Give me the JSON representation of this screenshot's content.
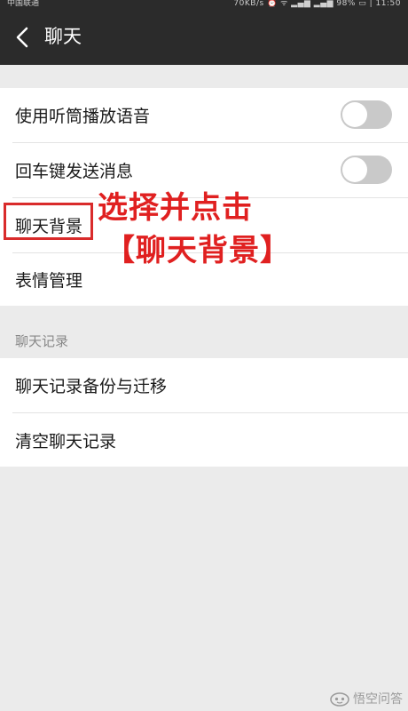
{
  "status_bar": {
    "carrier": "中国联通",
    "right_text": "70KB/s ⏰ ᯤ ▂▄▆ ▂▄▆ 98% ▭ | 11:50"
  },
  "nav": {
    "title": "聊天",
    "back_icon": "chevron-left-icon"
  },
  "settings": {
    "group1": [
      {
        "label": "使用听筒播放语音",
        "toggle": false
      },
      {
        "label": "回车键发送消息",
        "toggle": false
      },
      {
        "label": "聊天背景"
      },
      {
        "label": "表情管理"
      }
    ],
    "section_header": "聊天记录",
    "group2": [
      {
        "label": "聊天记录备份与迁移"
      },
      {
        "label": "清空聊天记录"
      }
    ]
  },
  "annotation": {
    "line1": "选择并点击",
    "line2": "【聊天背景】",
    "color": "#e02020"
  },
  "watermark": {
    "text": "悟空问答",
    "icon": "wukong-logo-icon"
  },
  "colors": {
    "nav_bg": "#2b2b2b",
    "page_bg": "#ebebeb",
    "toggle_off": "#c9c9c9",
    "highlight": "#d92b2b"
  }
}
